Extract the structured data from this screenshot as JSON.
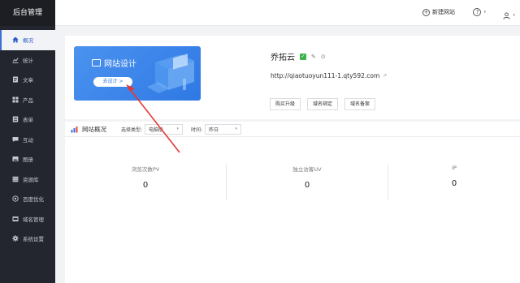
{
  "sidebar": {
    "title": "后台管理",
    "items": [
      {
        "label": "概况",
        "icon": "home-icon",
        "active": true
      },
      {
        "label": "统计",
        "icon": "stats-icon",
        "active": false
      },
      {
        "label": "文章",
        "icon": "article-icon",
        "active": false
      },
      {
        "label": "产品",
        "icon": "product-icon",
        "active": false
      },
      {
        "label": "表单",
        "icon": "form-icon",
        "active": false
      },
      {
        "label": "互动",
        "icon": "chat-icon",
        "active": false
      },
      {
        "label": "图册",
        "icon": "album-icon",
        "active": false
      },
      {
        "label": "资源库",
        "icon": "database-icon",
        "active": false
      },
      {
        "label": "百度优化",
        "icon": "seo-icon",
        "active": false
      },
      {
        "label": "域名管理",
        "icon": "domain-icon",
        "active": false
      },
      {
        "label": "系统设置",
        "icon": "gear-icon",
        "active": false
      }
    ]
  },
  "topbar": {
    "new_site": "新建网站",
    "help": "?"
  },
  "banner": {
    "title": "网站设计",
    "button": "去设计 >"
  },
  "site": {
    "name": "乔拓云",
    "url": "http://qiaotuoyun111-1.qty592.com",
    "actions": [
      "购买升级",
      "域名绑定",
      "域名备案"
    ]
  },
  "stats": {
    "title": "网站概况",
    "type_label": "选择类型:",
    "type_value": "电脑版",
    "time_label": "时间:",
    "time_value": "昨日",
    "metrics": [
      {
        "label": "浏览次数PV",
        "value": "0"
      },
      {
        "label": "独立访客UV",
        "value": "0"
      },
      {
        "label": "IP",
        "value": "0"
      }
    ]
  },
  "colors": {
    "sidebar": "#23262e",
    "accent": "#2f78e4",
    "annotation": "#e53935"
  }
}
